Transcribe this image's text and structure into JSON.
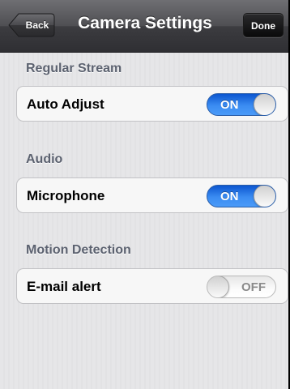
{
  "navbar": {
    "title": "Camera Settings",
    "back_label": "Back",
    "done_label": "Done"
  },
  "sections": [
    {
      "header": "Regular Stream",
      "row": {
        "label": "Auto Adjust",
        "state": "ON",
        "on": true
      }
    },
    {
      "header": "Audio",
      "row": {
        "label": "Microphone",
        "state": "ON",
        "on": true
      }
    },
    {
      "header": "Motion Detection",
      "row": {
        "label": "E-mail alert",
        "state": "OFF",
        "on": false
      }
    }
  ],
  "colors": {
    "switch_on": "#3b8cf2",
    "switch_off": "#ffffff",
    "section_header": "#5c6270"
  }
}
